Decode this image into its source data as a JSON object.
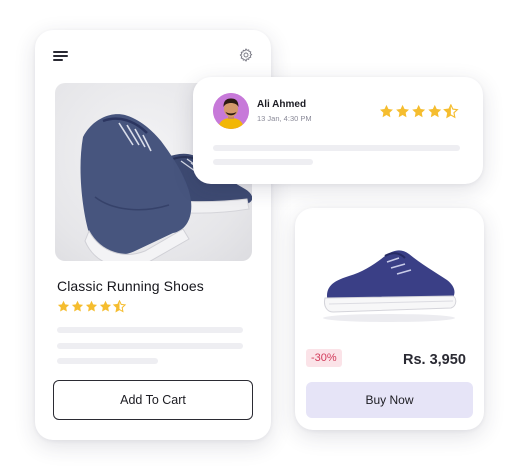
{
  "icons": {
    "menu": "hamburger-menu-icon",
    "settings": "gear-icon",
    "star_full": "star-icon",
    "star_half": "star-half-icon"
  },
  "colors": {
    "star": "#f5bd2f",
    "discount_bg": "#fbe3e8",
    "discount_text": "#d23b5a",
    "buy_now_bg": "#e6e4f7",
    "avatar_bg": "#c779d9"
  },
  "product": {
    "title": "Classic Running Shoes",
    "rating": 4.5,
    "add_to_cart_label": "Add To Cart"
  },
  "review": {
    "name": "Ali Ahmed",
    "date": "13 Jan, 4:30 PM",
    "rating": 4.5
  },
  "offer": {
    "discount": "-30%",
    "price": "Rs. 3,950",
    "buy_now_label": "Buy Now"
  }
}
